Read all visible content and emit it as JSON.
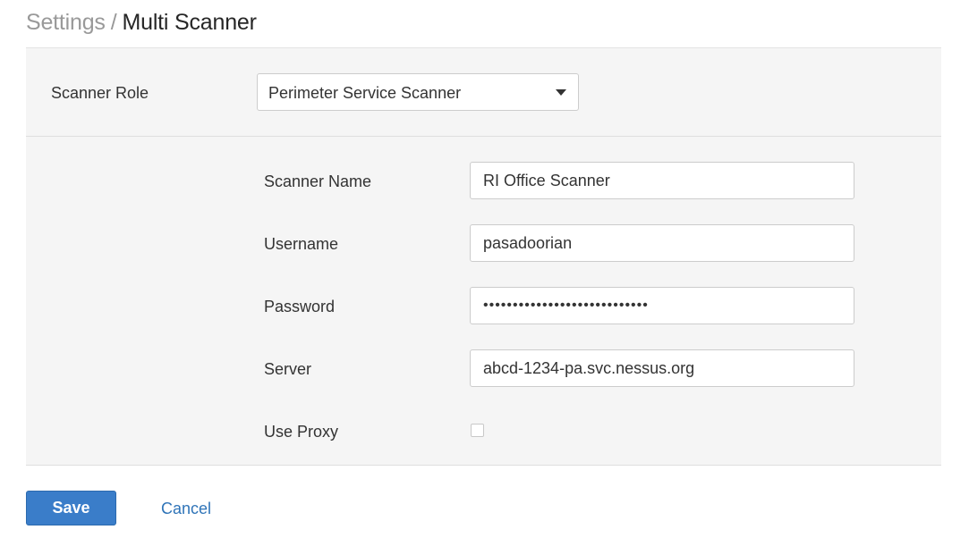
{
  "breadcrumb": {
    "parent": "Settings",
    "separator": "/",
    "current": "Multi Scanner"
  },
  "scanner_role": {
    "label": "Scanner Role",
    "selected": "Perimeter Service Scanner"
  },
  "fields": {
    "scanner_name": {
      "label": "Scanner Name",
      "value": "RI Office Scanner"
    },
    "username": {
      "label": "Username",
      "value": "pasadoorian"
    },
    "password": {
      "label": "Password",
      "value": "••••••••••••••••••••••••••••"
    },
    "server": {
      "label": "Server",
      "value": "abcd-1234-pa.svc.nessus.org"
    },
    "use_proxy": {
      "label": "Use Proxy",
      "checked": false
    }
  },
  "actions": {
    "save_label": "Save",
    "cancel_label": "Cancel"
  },
  "colors": {
    "primary_button": "#3a7dc9",
    "link": "#2f74b8",
    "panel_background": "#f5f5f5"
  },
  "icons": {
    "dropdown": "caret-down-icon"
  }
}
